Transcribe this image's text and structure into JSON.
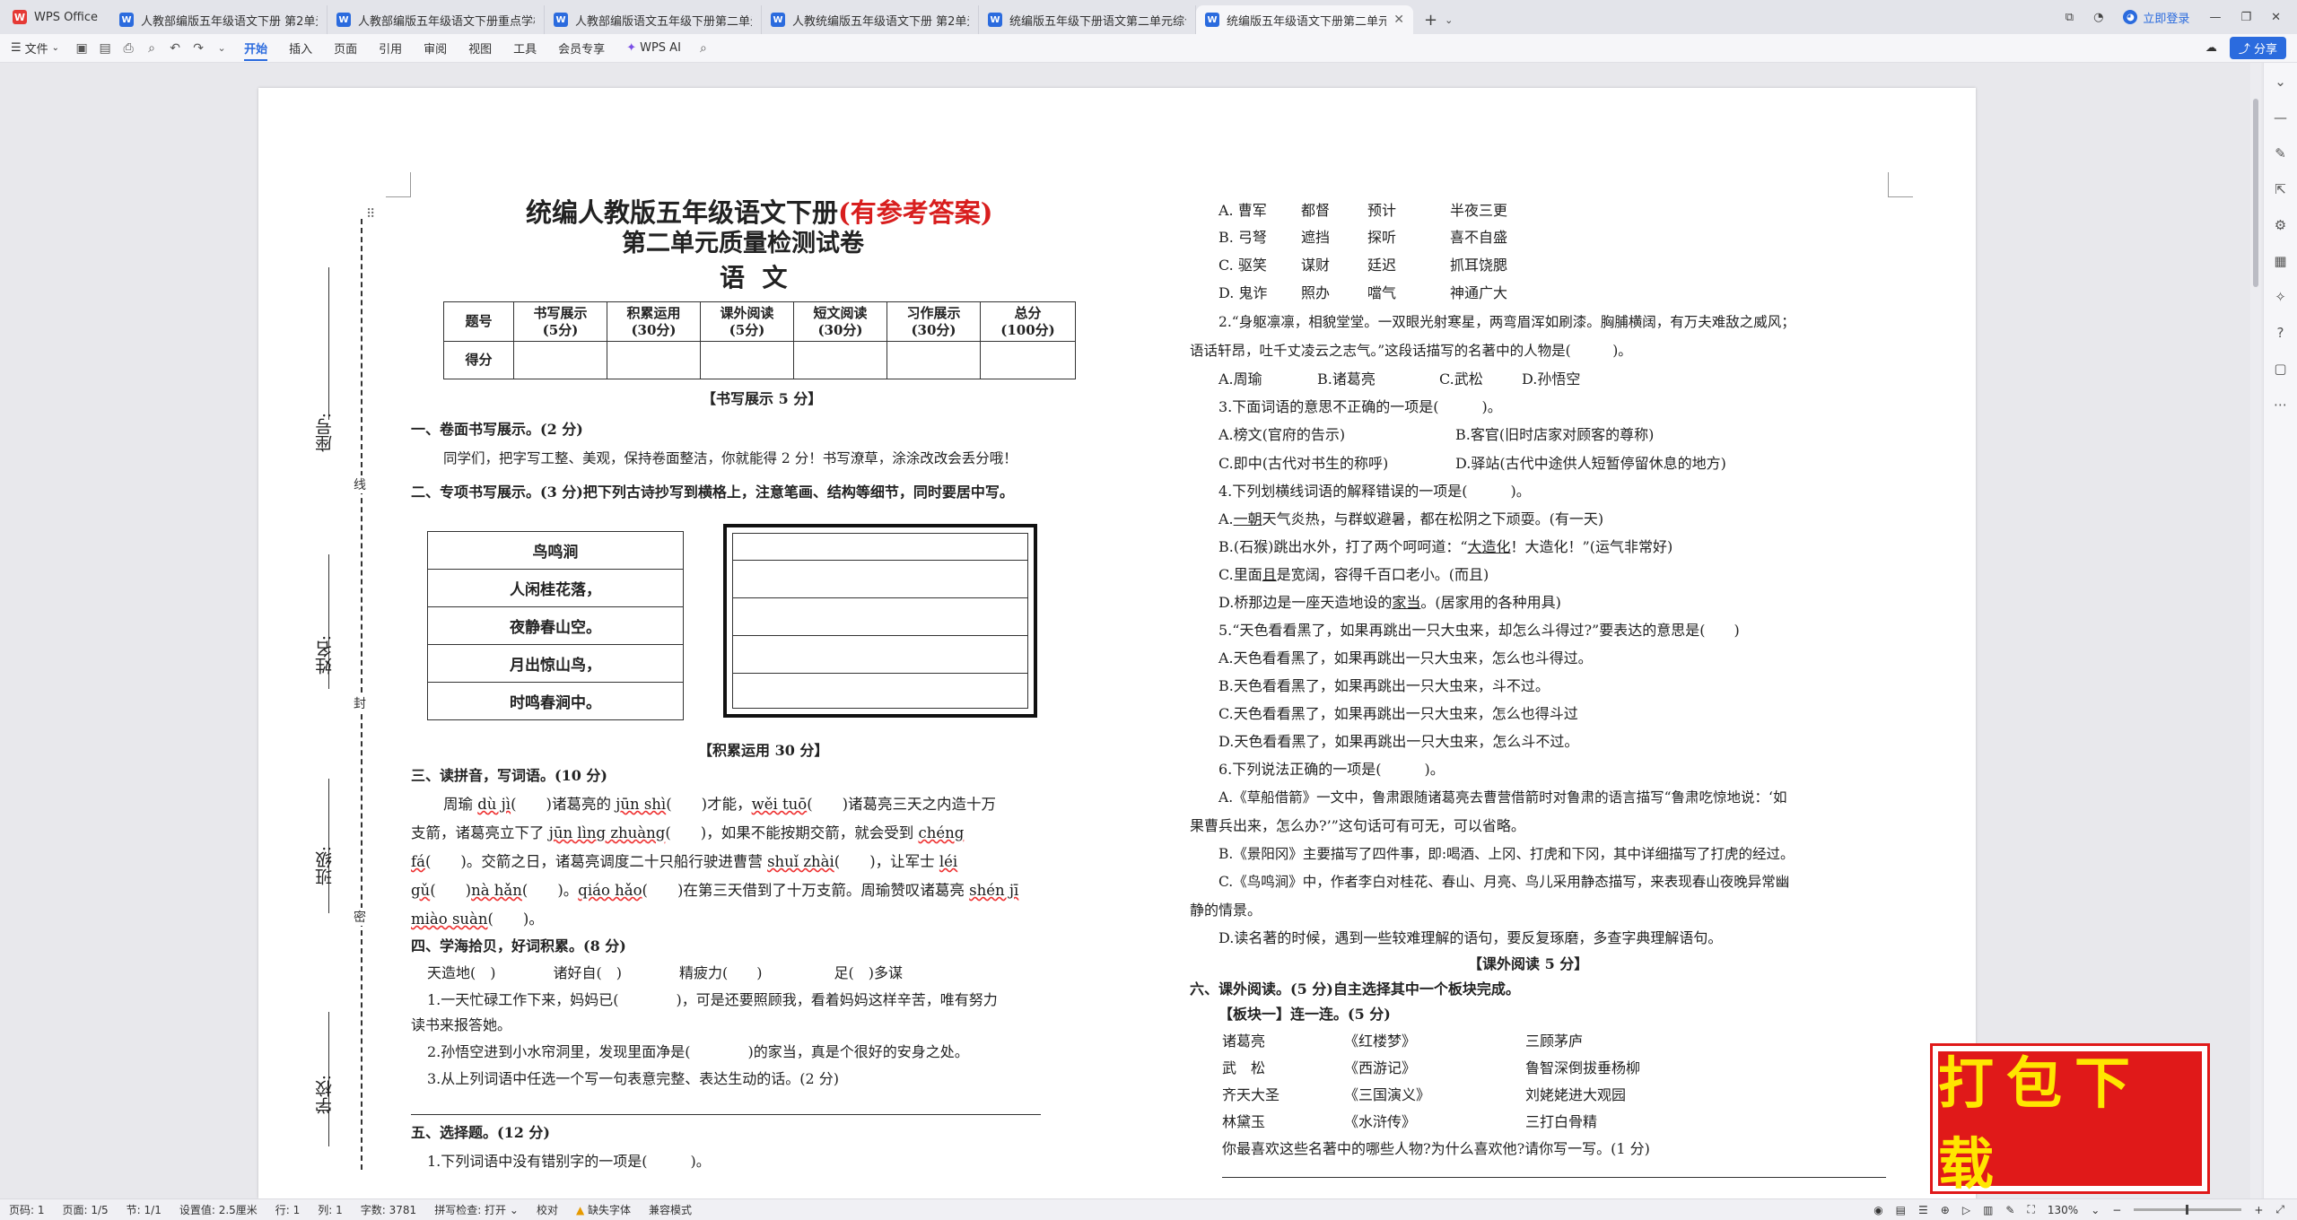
{
  "app": {
    "name": "WPS Office"
  },
  "tabs": [
    {
      "label": "人教部编版五年级语文下册 第2单元"
    },
    {
      "label": "人教部编版五年级语文下册重点学校"
    },
    {
      "label": "人教部编版语文五年级下册第二单元"
    },
    {
      "label": "人教统编版五年级语文下册 第2单元"
    },
    {
      "label": "统编版五年级下册语文第二单元综合"
    },
    {
      "label": "统编版五年级语文下册第二单元"
    }
  ],
  "titlebar": {
    "login": "立即登录"
  },
  "ribbon": {
    "file": "文件",
    "items": [
      "开始",
      "插入",
      "页面",
      "引用",
      "审阅",
      "视图",
      "工具",
      "会员专享"
    ],
    "ai": "WPS AI",
    "share": "分享"
  },
  "binding": {
    "seat": "座号:",
    "name": "姓名:",
    "class": "班级:",
    "school": "学校:",
    "c1": "线",
    "c2": "封",
    "c3": "密"
  },
  "doc": {
    "title1": "统编人教版五年级语文下册",
    "title1_red": "(有参考答案)",
    "title2": "第二单元质量检测试卷",
    "title3": "语  文",
    "score_table": {
      "headers": [
        "题号",
        "书写展示\n(5分)",
        "积累运用\n(30分)",
        "课外阅读\n(5分)",
        "短文阅读\n(30分)",
        "习作展示\n(30分)",
        "总分\n(100分)"
      ],
      "row2": "得分"
    },
    "sec_write": "【书写展示 5 分】",
    "q1": "一、卷面书写展示。(2 分)",
    "q1_text": "同学们，把字写工整、美观，保持卷面整洁，你就能得 2 分！书写潦草，涂涂改改会丢分哦！",
    "q2": "二、专项书写展示。(3 分)把下列古诗抄写到横格上，注意笔画、结构等细节，同时要居中写。",
    "poem": [
      "鸟鸣涧",
      "人闲桂花落，",
      "夜静春山空。",
      "月出惊山鸟，",
      "时鸣春涧中。"
    ],
    "sec_acc": "【积累运用 30 分】",
    "q3": "三、读拼音，写词语。(10 分)",
    "q3_lines": [
      [
        "周瑜 ",
        "dù jì",
        "(　　)诸葛亮的 ",
        "jūn shì",
        "(　　)才能，",
        "wěi tuō",
        "(　　)诸葛亮三天之内造十万"
      ],
      [
        "支箭，诸葛亮立下了 ",
        "jūn lìng zhuàng",
        "(　　)，如果不能按期交箭，就会受到 ",
        "chéng"
      ],
      [
        "fá",
        "(　　)。交箭之日，诸葛亮调度二十只船行驶进曹营 ",
        "shuǐ zhài",
        "(　　)，让军士 ",
        "léi"
      ],
      [
        "gǔ",
        "(　　)",
        "nà hǎn",
        "(　　)。",
        "qiáo hǎo",
        "(　　)在第三天借到了十万支箭。周瑜赞叹诸葛亮 ",
        "shén jī"
      ],
      [
        "miào suàn",
        "(　　)。"
      ]
    ],
    "q4": "四、学海拾贝，好词积累。(8 分)",
    "q4_fill": "天造地(　)　　　　诸好自(　)　　　　精疲力(　　)　　　　　足(　)多谋",
    "q4_1a": "1.一天忙碌工作下来，妈妈已(　　　　)，可是还要照顾我，看着妈妈这样辛苦，唯有努力",
    "q4_1b": "读书来报答她。",
    "q4_2": "2.孙悟空进到小水帘洞里，发现里面净是(　　　　)的家当，真是个很好的安身之处。",
    "q4_3": "3.从上列词语中任选一个写一句表意完整、表达生动的话。(2 分)",
    "q5": "五、选择题。(12 分)",
    "q5_1": "1.下列词语中没有错别字的一项是(　　　)。",
    "r_options": [
      [
        "A. 曹军",
        "都督",
        "预计",
        "半夜三更"
      ],
      [
        "B. 弓弩",
        "遮挡",
        "探听",
        "喜不自盛"
      ],
      [
        "C. 驱笑",
        "谋财",
        "廷迟",
        "抓耳饶腮"
      ],
      [
        "D. 鬼诈",
        "照办",
        "噹气",
        "神通广大"
      ]
    ],
    "r2a": "2.“身躯凛凛，相貌堂堂。一双眼光射寒星，两弯眉浑如刷漆。胸脯横阔，有万夫难敌之威风；",
    "r2b": "语话轩昂，吐千丈凌云之志气。”这段话描写的名著中的人物是(　　　)。",
    "r2_opts": [
      "A.周瑜",
      "B.诸葛亮",
      "C.武松",
      "D.孙悟空"
    ],
    "r3": "3.下面词语的意思不正确的一项是(　　　)。",
    "r3_a": "A.榜文(官府的告示)",
    "r3_b": "B.客官(旧时店家对顾客的尊称)",
    "r3_c": "C.即中(古代对书生的称呼)",
    "r3_d": "D.驿站(古代中途供人短暂停留休息的地方)",
    "r4": "4.下列划横线词语的解释错误的一项是(　　　)。",
    "r4_a": [
      "A.",
      "一朝",
      "天气炎热，与群蚁避暑，都在松阴之下顽耍。(有一天)"
    ],
    "r4_b": [
      "B.(石猴)跳出水外，打了两个呵呵道：“",
      "大造化",
      "！大造化！”(运气非常好)"
    ],
    "r4_c": [
      "C.里面",
      "且",
      "是宽阔，容得千百口老小。(而且)"
    ],
    "r4_d": [
      "D.桥那边是一座天造地设的",
      "家当",
      "。(居家用的各种用具)"
    ],
    "r5": "5.“天色看看黑了，如果再跳出一只大虫来，却怎么斗得过?”要表达的意思是(　　)",
    "r5_opts": [
      "A.天色看看黑了，如果再跳出一只大虫来，怎么也斗得过。",
      "B.天色看看黑了，如果再跳出一只大虫来，斗不过。",
      "C.天色看看黑了，如果再跳出一只大虫来，怎么也得斗过",
      "D.天色看看黑了，如果再跳出一只大虫来，怎么斗不过。"
    ],
    "r6": "6.下列说法正确的一项是(　　　)。",
    "r6_a1": "A.《草船借箭》一文中，鲁肃跟随诸葛亮去曹营借箭时对鲁肃的语言描写“鲁肃吃惊地说：‘如",
    "r6_a2": "果曹兵出来，怎么办?’”这句话可有可无，可以省略。",
    "r6_b": "B.《景阳冈》主要描写了四件事，即:喝酒、上冈、打虎和下冈，其中详细描写了打虎的经过。",
    "r6_c1": "C.《鸟鸣涧》中，作者李白对桂花、春山、月亮、鸟儿采用静态描写，来表现春山夜晚异常幽",
    "r6_c2": "静的情景。",
    "r6_d": "D.读名著的时候，遇到一些较难理解的语句，要反复琢磨，多查字典理解语句。",
    "sec_read": "【课外阅读 5 分】",
    "q6": "六、课外阅读。(5 分)自主选择其中一个板块完成。",
    "block1": "【板块一】连一连。(5 分)",
    "match": [
      [
        "诸葛亮",
        "《红楼梦》",
        "三顾茅庐"
      ],
      [
        "武　松",
        "《西游记》",
        "鲁智深倒拔垂杨柳"
      ],
      [
        "齐天大圣",
        "《三国演义》",
        "刘姥姥进大观园"
      ],
      [
        "林黛玉",
        "《水浒传》",
        "三打白骨精"
      ]
    ],
    "match_q": "你最喜欢这些名著中的哪些人物?为什么喜欢他?请你写一写。(1 分)"
  },
  "download_badge": "打包下载",
  "status": {
    "page": "页码: 1",
    "pages": "页面: 1/5",
    "section": "节: 1/1",
    "setting": "设置值: 2.5厘米",
    "row": "行: 1",
    "col": "列: 1",
    "words": "字数: 3781",
    "spell": "拼写检查: 打开",
    "proof": "校对",
    "font_missing": "缺失字体",
    "compat": "兼容模式",
    "zoom": "130%"
  }
}
